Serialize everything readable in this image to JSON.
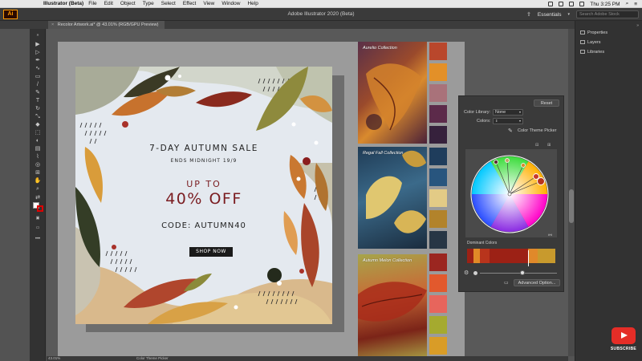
{
  "menubar": {
    "app_name": "Illustrator (Beta)",
    "items": [
      "File",
      "Edit",
      "Object",
      "Type",
      "Select",
      "Effect",
      "View",
      "Window",
      "Help"
    ],
    "clock": "Thu 3:25 PM"
  },
  "titlebar": {
    "logo": "Ai",
    "title": "Adobe Illustrator 2020 (Beta)",
    "workspace": "Essentials",
    "search_placeholder": "Search Adobe Stock"
  },
  "document_tab": {
    "close": "×",
    "label": "Recolor Artwork.ai* @ 43.01% (RGB/GPU Preview)"
  },
  "artwork": {
    "title": "7-DAY AUTUMN SALE",
    "subtitle": "ENDS MIDNIGHT 19/9",
    "up_to": "UP TO",
    "discount": "40% OFF",
    "code": "CODE: AUTUMN40",
    "button": "SHOP NOW"
  },
  "collections": [
    {
      "caption": "Aurelio Collection",
      "swatches": [
        "#b9472c",
        "#e39028",
        "#a9727a",
        "#5c2a4a",
        "#36213c"
      ]
    },
    {
      "caption": "Regal Fall Collection",
      "swatches": [
        "#1f3d5c",
        "#28557e",
        "#e3cb86",
        "#b2832b",
        "#273645"
      ]
    },
    {
      "caption": "Autumn Melon Collection",
      "swatches": [
        "#9b2620",
        "#e2592d",
        "#e7655c",
        "#a5aa2f",
        "#d99c27"
      ]
    }
  ],
  "recolor": {
    "reset": "Reset",
    "color_library_label": "Color Library:",
    "color_library_value": "None",
    "colors_label": "Colors:",
    "colors_value": "",
    "theme_picker": "Color Theme Picker",
    "dominant_label": "Dominant Colors",
    "dominant_colors": [
      "#9c2115",
      "#e18a27",
      "#b8341c",
      "#9c2115",
      "#9c2115",
      "#e0892a",
      "#c89a2d"
    ],
    "advanced": "Advanced Option..."
  },
  "panels": [
    "Properties",
    "Layers",
    "Libraries"
  ],
  "status": {
    "zoom": "43.01%",
    "tool": "Color Theme Picker"
  },
  "youtube": {
    "label": "SUBSCRIBE"
  }
}
